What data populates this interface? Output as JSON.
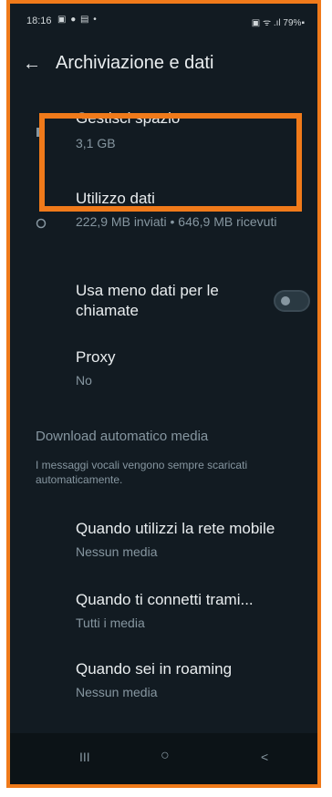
{
  "status_bar": {
    "time": "18:16",
    "icons_left": "▣ ● ▤ •",
    "right": "▣ ᯤ .ıl 79%▪"
  },
  "app_bar": {
    "back_icon": "arrow-back-icon",
    "title": "Archiviazione e dati"
  },
  "items": [
    {
      "label": "Gestisci spazio",
      "subtitle": "3,1 GB"
    },
    {
      "label": "Utilizzo dati",
      "subtitle": "222,9 MB inviati • 646,9 MB ricevuti"
    },
    {
      "label": "Usa meno dati per le chiamate",
      "toggle_on": false
    },
    {
      "label": "Proxy",
      "subtitle": "No"
    }
  ],
  "media_section": {
    "title": "Download automatico media",
    "note": "I messaggi vocali vengono sempre scaricati automaticamente.",
    "options": [
      {
        "label": "Quando utilizzi la rete mobile",
        "value": "Nessun media"
      },
      {
        "label": "Quando ti connetti trami...",
        "value": "Tutti i media"
      },
      {
        "label": "Quando sei in roaming",
        "value": "Nessun media"
      }
    ]
  },
  "nav_bar": {
    "recents": "III",
    "home": "○",
    "back": "<"
  },
  "colors": {
    "background": "#121b22",
    "frame_highlight": "#f07a1a"
  }
}
